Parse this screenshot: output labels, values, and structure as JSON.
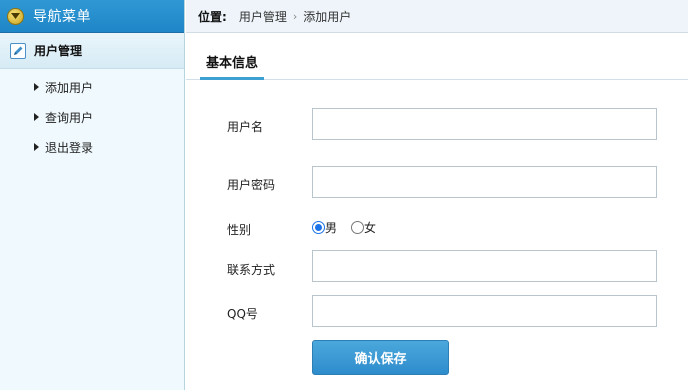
{
  "sidebar": {
    "title": "导航菜单",
    "group": {
      "label": "用户管理"
    },
    "items": [
      {
        "label": "添加用户"
      },
      {
        "label": "查询用户"
      },
      {
        "label": "退出登录"
      }
    ]
  },
  "topbar": {
    "location_label": "位置:",
    "crumbs": [
      "用户管理",
      "添加用户"
    ],
    "separator": "›"
  },
  "tab": {
    "label": "基本信息"
  },
  "form": {
    "username_label": "用户名",
    "username_value": "",
    "password_label": "用户密码",
    "password_value": "",
    "gender_label": "性别",
    "gender_options": [
      {
        "label": "男",
        "checked": true
      },
      {
        "label": "女",
        "checked": false
      }
    ],
    "contact_label": "联系方式",
    "contact_value": "",
    "qq_label": "QQ号",
    "qq_value": "",
    "save_label": "确认保存"
  },
  "colors": {
    "header_blue": "#2f98d4",
    "accent": "#3da0d3",
    "radio_checked": "#1a73e8"
  }
}
